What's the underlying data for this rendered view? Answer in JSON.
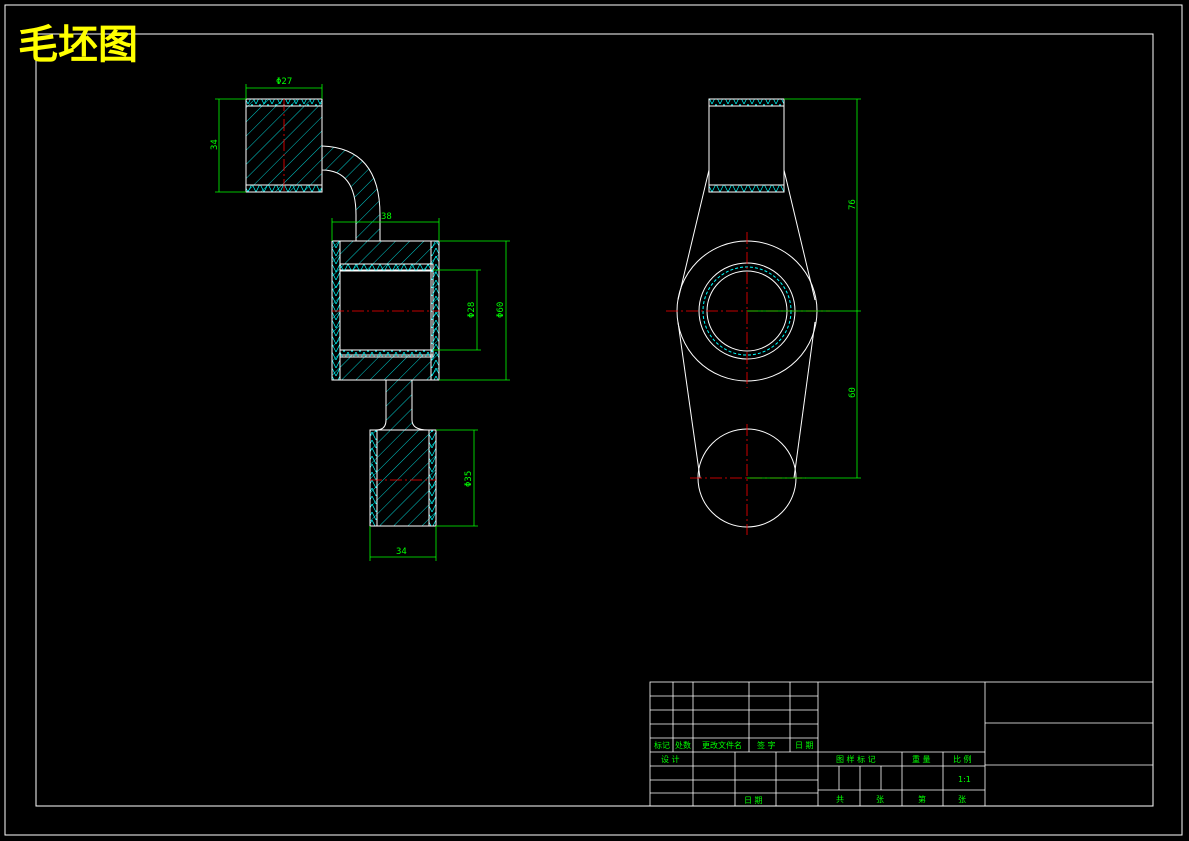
{
  "title": "毛坯图",
  "colors": {
    "background": "#000000",
    "frame": "#ffffff",
    "title": "#ffff00",
    "dimension": "#00ff00",
    "centerline": "#ff0000",
    "hatch": "#00ffff"
  },
  "dimensions": {
    "top_width": "Φ27",
    "top_height": "34",
    "stem_width": "38",
    "bore_inner": "Φ28",
    "bore_outer": "Φ60",
    "bottom_diameter": "Φ35",
    "bottom_width": "34",
    "side_upper": "76",
    "side_lower": "60"
  },
  "title_block": {
    "mark": "标记",
    "count": "处数",
    "change_doc": "更改文件名",
    "signature": "签 字",
    "date": "日 期",
    "design": "设 计",
    "date2": "日 期",
    "stage_mark": "图 样 标 记",
    "weight": "重 量",
    "scale_label": "比 例",
    "scale": "1:1",
    "total": "共",
    "sheets": "张",
    "page": "第",
    "sheet_word": "张"
  }
}
